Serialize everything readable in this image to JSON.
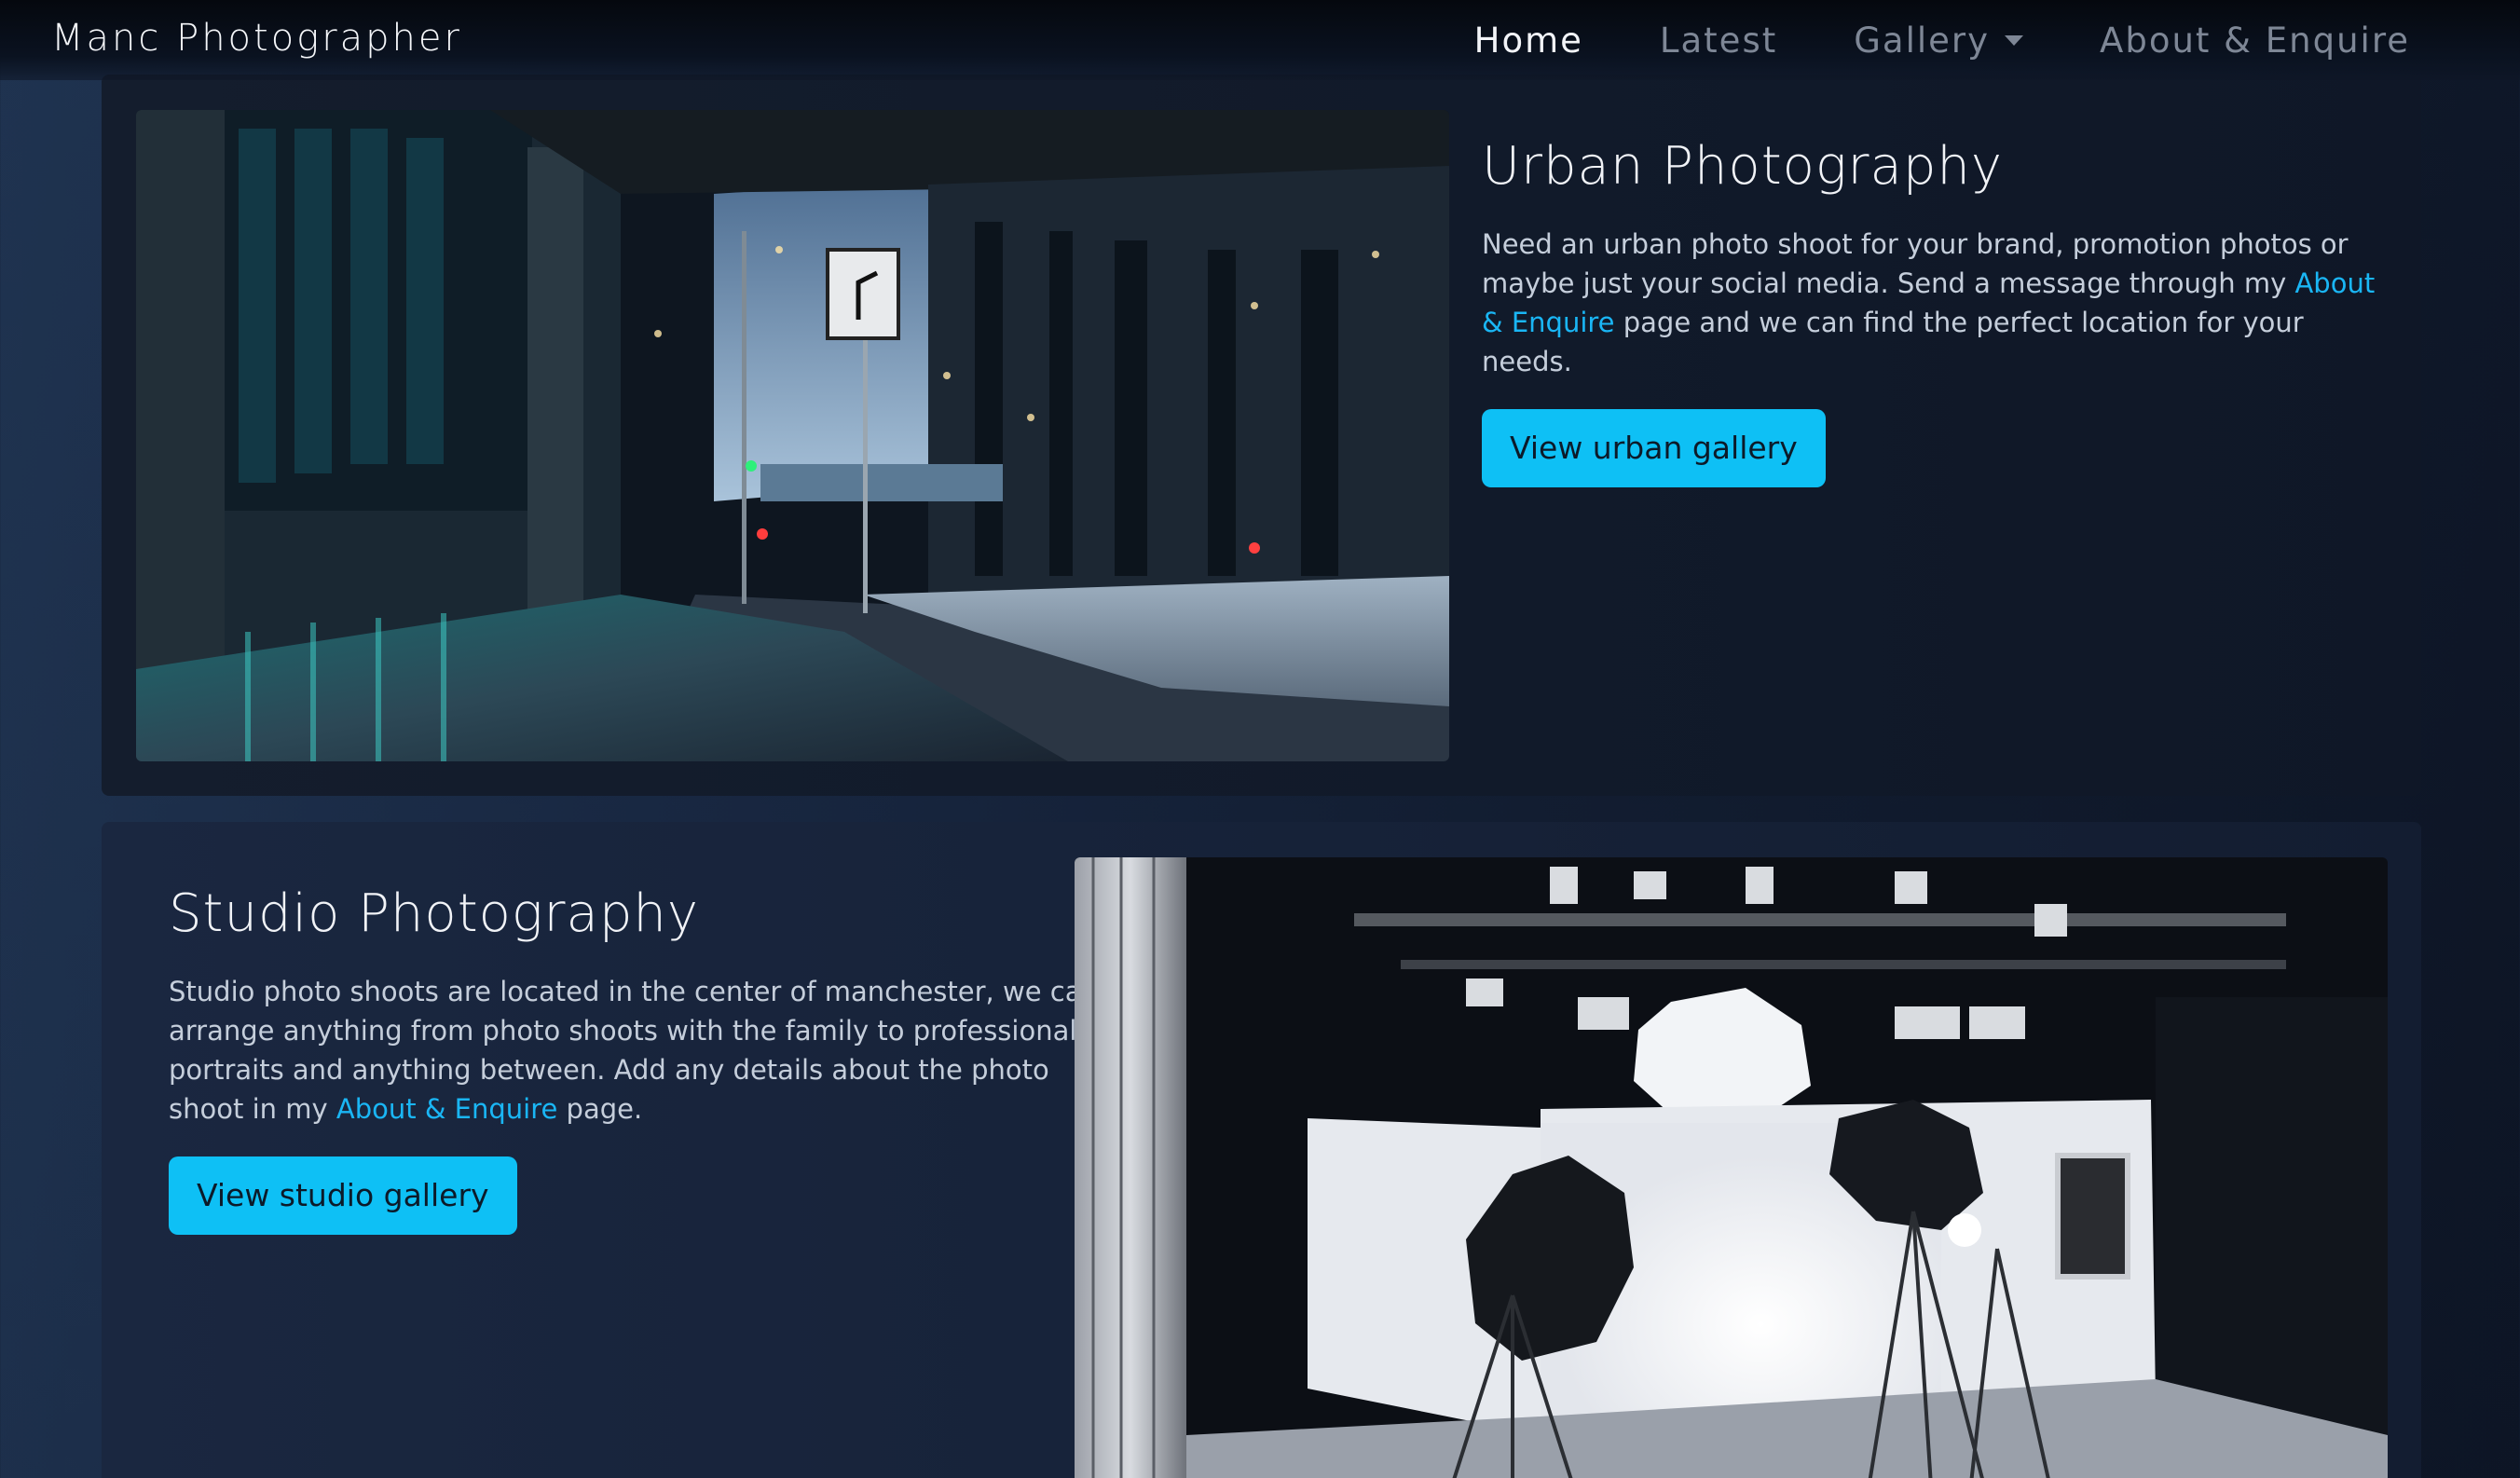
{
  "navbar": {
    "brand": "Manc Photographer",
    "links": [
      {
        "label": "Home",
        "active": true
      },
      {
        "label": "Latest",
        "active": false
      },
      {
        "label": "Gallery",
        "active": false,
        "dropdown": true
      },
      {
        "label": "About & Enquire",
        "active": false
      }
    ]
  },
  "urban": {
    "title": "Urban Photography",
    "text_before": "Need an urban photo shoot for your brand, promotion photos or maybe just your social media. Send a message through my ",
    "link": "About & Enquire",
    "text_after": " page and we can find the perfect location for your needs.",
    "button": "View urban gallery"
  },
  "studio": {
    "title": "Studio Photography",
    "text_before": "Studio photo shoots are located in the center of manchester, we can arrange anything from photo shoots with the family to professional portraits and anything between. Add any details about the photo shoot in my ",
    "link": "About & Enquire",
    "text_after": " page.",
    "button": "View studio gallery"
  },
  "colors": {
    "accent": "#0ec0f5",
    "link": "#1ab6f5",
    "background": "#17233a"
  }
}
